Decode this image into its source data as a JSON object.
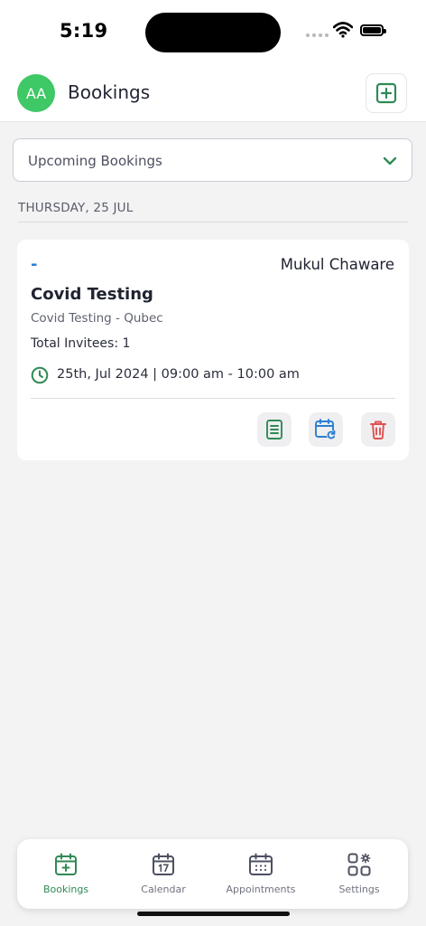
{
  "status_bar": {
    "time": "5:19"
  },
  "header": {
    "avatar_initials": "AA",
    "title": "Bookings"
  },
  "filter": {
    "selected": "Upcoming Bookings"
  },
  "date_group": {
    "label": "THURSDAY, 25 JUL"
  },
  "booking": {
    "status_mark": "-",
    "host": "Mukul Chaware",
    "title": "Covid Testing",
    "subtitle": "Covid Testing - Qubec",
    "invitees": "Total Invitees: 1",
    "datetime": "25th, Jul 2024 | 09:00 am - 10:00 am"
  },
  "tabs": [
    {
      "label": "Bookings",
      "icon": "calendar-plus-icon",
      "active": true
    },
    {
      "label": "Calendar",
      "icon": "calendar-17-icon",
      "active": false
    },
    {
      "label": "Appointments",
      "icon": "calendar-grid-icon",
      "active": false
    },
    {
      "label": "Settings",
      "icon": "apps-gear-icon",
      "active": false
    }
  ],
  "colors": {
    "accent_green": "#2f8a55",
    "avatar_green": "#3ec866",
    "link_blue": "#2b7fd4",
    "delete_red": "#e05050",
    "background": "#f3f3f4"
  }
}
